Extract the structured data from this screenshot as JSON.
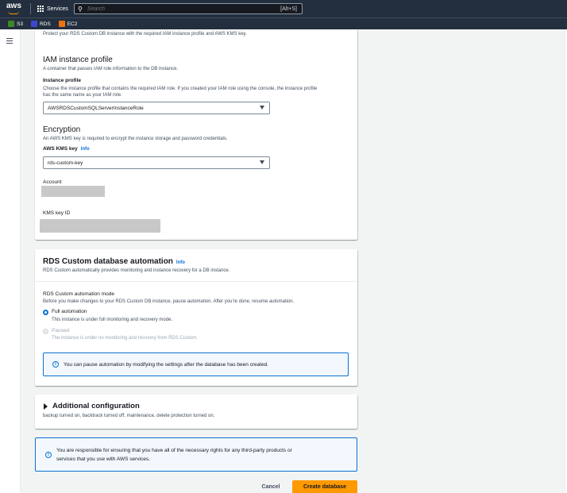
{
  "topnav": {
    "logo": "aws",
    "services_label": "Services",
    "search_placeholder": "Search",
    "search_shortcut": "[Alt+S]"
  },
  "favorites": [
    {
      "label": "S3",
      "icon": "s3-icon",
      "color": "#3f8624"
    },
    {
      "label": "RDS",
      "icon": "rds-icon",
      "color": "#3b48cc"
    },
    {
      "label": "EC2",
      "icon": "ec2-icon",
      "color": "#ec7211"
    }
  ],
  "iam_section": {
    "top_text": "Protect your RDS Custom DB instance with the required IAM instance profile and AWS KMS key.",
    "title": "IAM instance profile",
    "description": "A container that passes IAM role information to the DB instance.",
    "field_label": "Instance profile",
    "field_help_1": "Choose the instance profile that contains the required IAM role. If you created your IAM role using the console, the instance profile",
    "field_help_2": "has the same name as your IAM role.",
    "selected": "AWSRDSCustomSQLServerInstanceRole"
  },
  "encryption": {
    "title": "Encryption",
    "description": "An AWS KMS key is required to encrypt the instance storage and password credentials.",
    "kms_label": "AWS KMS key",
    "info": "Info",
    "selected": "rds-custom-key",
    "account_label": "Account",
    "kms_key_id_label": "KMS key ID"
  },
  "automation": {
    "title": "RDS Custom database automation",
    "info": "Info",
    "description": "RDS Custom automatically provides monitoring and instance recovery for a DB instance.",
    "mode_label": "RDS Custom automation mode",
    "mode_help": "Before you make changes to your RDS Custom DB instance, pause automation. After you're done, resume automation.",
    "options": [
      {
        "label": "Full automation",
        "desc": "This instance is under full monitoring and recovery mode.",
        "selected": true
      },
      {
        "label": "Paused",
        "desc": "The instance is under no monitoring and recovery from RDS Custom.",
        "selected": false
      }
    ],
    "alert": "You can pause automation by modifying the settings after the database has been created."
  },
  "additional": {
    "title": "Additional configuration",
    "description": "backup turned on, backtrack turned off, maintenance, delete protection turned on."
  },
  "notice": {
    "line1": "You are responsible for ensuring that you have all of the necessary rights for any third-party products or",
    "line2": "services that you use with AWS services."
  },
  "actions": {
    "cancel": "Cancel",
    "create": "Create database"
  }
}
